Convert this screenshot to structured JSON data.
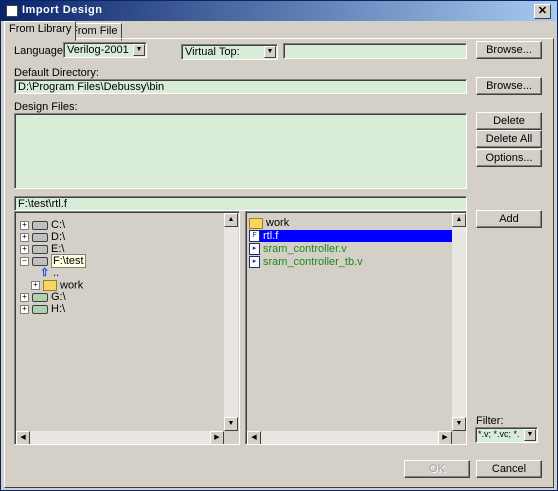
{
  "window": {
    "title": "Import Design"
  },
  "tabs": [
    {
      "label": "From Library",
      "active": true
    },
    {
      "label": "From File",
      "active": false
    }
  ],
  "language": {
    "label": "Language:",
    "value": "Verilog-2001"
  },
  "virtual_top": {
    "value": "Virtual Top:",
    "input_value": ""
  },
  "browse1": {
    "label": "Browse..."
  },
  "default_directory": {
    "label": "Default Directory:",
    "value": "D:\\Program Files\\Debussy\\bin"
  },
  "browse2": {
    "label": "Browse..."
  },
  "design_files": {
    "label": "Design Files:"
  },
  "buttons": {
    "delete": "Delete",
    "delete_all": "Delete All",
    "options": "Options...",
    "add": "Add",
    "ok": "OK",
    "cancel": "Cancel"
  },
  "path_field": {
    "value": "F:\\test\\rtl.f"
  },
  "tree": [
    {
      "label": "C:\\",
      "icon": "drive-icon"
    },
    {
      "label": "D:\\",
      "icon": "drive-icon"
    },
    {
      "label": "E:\\",
      "icon": "drive-icon"
    },
    {
      "label": "F:\\test",
      "icon": "drive-icon"
    },
    {
      "label": "..",
      "icon": "up-arrow-icon"
    },
    {
      "label": "work",
      "icon": "folder-icon"
    },
    {
      "label": "G:\\",
      "icon": "network-drive-icon"
    },
    {
      "label": "H:\\",
      "icon": "network-drive-icon"
    }
  ],
  "files": [
    {
      "label": "work",
      "icon": "folder-icon"
    },
    {
      "label": "rtl.f",
      "icon": "file-f-icon"
    },
    {
      "label": "sram_controller.v",
      "icon": "verilog-file-icon"
    },
    {
      "label": "sram_controller_tb.v",
      "icon": "verilog-file-icon"
    }
  ],
  "filter": {
    "label": "Filter:",
    "value": "*.v; *.vc; *."
  },
  "colors": {
    "field_bg": "#d8ecd8",
    "selection": "#0000ff",
    "file_text": "#1a8a1a"
  }
}
